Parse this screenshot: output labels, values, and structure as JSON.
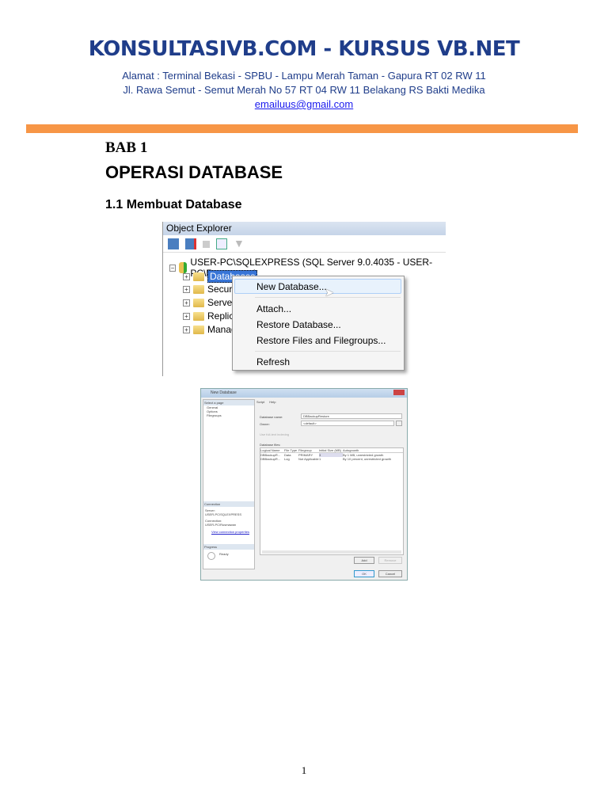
{
  "header": {
    "title": "KONSULTASIVB.COM - KURSUS VB.NET",
    "address1": "Alamat : Terminal Bekasi - SPBU - Lampu Merah Taman - Gapura RT 02 RW 11",
    "address2": "Jl. Rawa Semut - Semut Merah No 57 RT 04 RW 11 Belakang RS Bakti Medika",
    "email": "emailuus@gmail.com"
  },
  "chapter": {
    "label": "BAB 1",
    "title": "OPERASI DATABASE",
    "section": "1.1 Membuat Database"
  },
  "object_explorer": {
    "title": "Object Explorer",
    "server": "USER-PC\\SQLEXPRESS (SQL Server 9.0.4035 - USER-PC\\Rusmawan)",
    "nodes": [
      "Databases",
      "Securit",
      "Server",
      "Replica",
      "Manag"
    ],
    "menu": [
      "New Database...",
      "Attach...",
      "Restore Database...",
      "Restore Files and Filegroups...",
      "Refresh"
    ]
  },
  "new_db_dialog": {
    "title": "New Database",
    "select_page": "Select a page",
    "pages": [
      "General",
      "Options",
      "Filegroups"
    ],
    "script": "Script",
    "help": "Help",
    "db_name_label": "Database name:",
    "db_name": "DBBackupRestore",
    "owner_label": "Owner:",
    "owner": "<default>",
    "fulltext": "Use full-text indexing",
    "files_label": "Database files:",
    "columns": [
      "Logical Name",
      "File Type",
      "Filegroup",
      "Initial Size (MB)",
      "Autogrowth"
    ],
    "rows": [
      [
        "DBBackupR...",
        "Data",
        "PRIMARY",
        "3",
        "By 1 MB, unrestricted growth"
      ],
      [
        "DBBackupR...",
        "Log",
        "Not Applicable",
        "1",
        "By 10 percent, unrestricted growth"
      ]
    ],
    "connection": "Connection",
    "server_label": "Server:",
    "server": "USER-PC\\SQLEXPRESS",
    "conn_label": "Connection:",
    "conn": "USER-PC\\Rusmawan",
    "view_props": "View connection properties",
    "progress": "Progress",
    "ready": "Ready",
    "add": "Add",
    "remove": "Remove",
    "ok": "OK",
    "cancel": "Cancel"
  },
  "page_number": "1"
}
